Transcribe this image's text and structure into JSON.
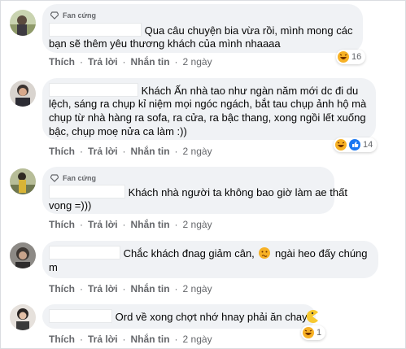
{
  "comments": [
    {
      "badge": "Fan cứng",
      "lines": [
        "Qua câu chuyện bia vừa rồi, mình mong các",
        "bạn sẽ thêm yêu thương khách của mình nhaaaa"
      ],
      "reaction_count": "16",
      "time": "2 ngày"
    },
    {
      "badge": "",
      "lines": [
        "Khách Ấn nhà tao như ngàn năm mới dc đi du",
        "lệch, sáng ra chụp kỉ niệm mọi ngóc ngách, bắt tau chụp ảnh hộ mà",
        "chụp từ nhà hàng ra sofa, ra cửa, ra bậc thang, xong ngồi lết xuống",
        "bậc, chụp moẹ nửa ca làm :))"
      ],
      "reaction_count": "14",
      "time": "2 ngày"
    },
    {
      "badge": "Fan cứng",
      "lines": [
        "Khách nhà người ta không bao giờ làm ae thất",
        "vọng =)))"
      ],
      "reaction_count": "",
      "time": "2 ngày"
    },
    {
      "badge": "",
      "lines": [
        "Chắc khách đnag giảm cân,",
        "ngài heo đấy chúng",
        "m"
      ],
      "reaction_count": "",
      "time": "2 ngày"
    },
    {
      "badge": "",
      "lines": [
        "Ord về xong chợt nhớ hnay phải ăn chay"
      ],
      "reaction_count": "1",
      "time": "2 ngày"
    }
  ],
  "actions": {
    "like": "Thích",
    "reply": "Trả lời",
    "message": "Nhắn tin",
    "separator": "·"
  },
  "colors": {
    "bubble": "#f0f2f5",
    "action_text": "#65676b",
    "haha_yellow": "#f7b125",
    "like_blue": "#1877f2"
  },
  "icons": [
    "fan-diamond-icon",
    "haha-reaction-icon",
    "like-reaction-icon",
    "confused-emoji-icon",
    "pacman-emoji-icon"
  ]
}
